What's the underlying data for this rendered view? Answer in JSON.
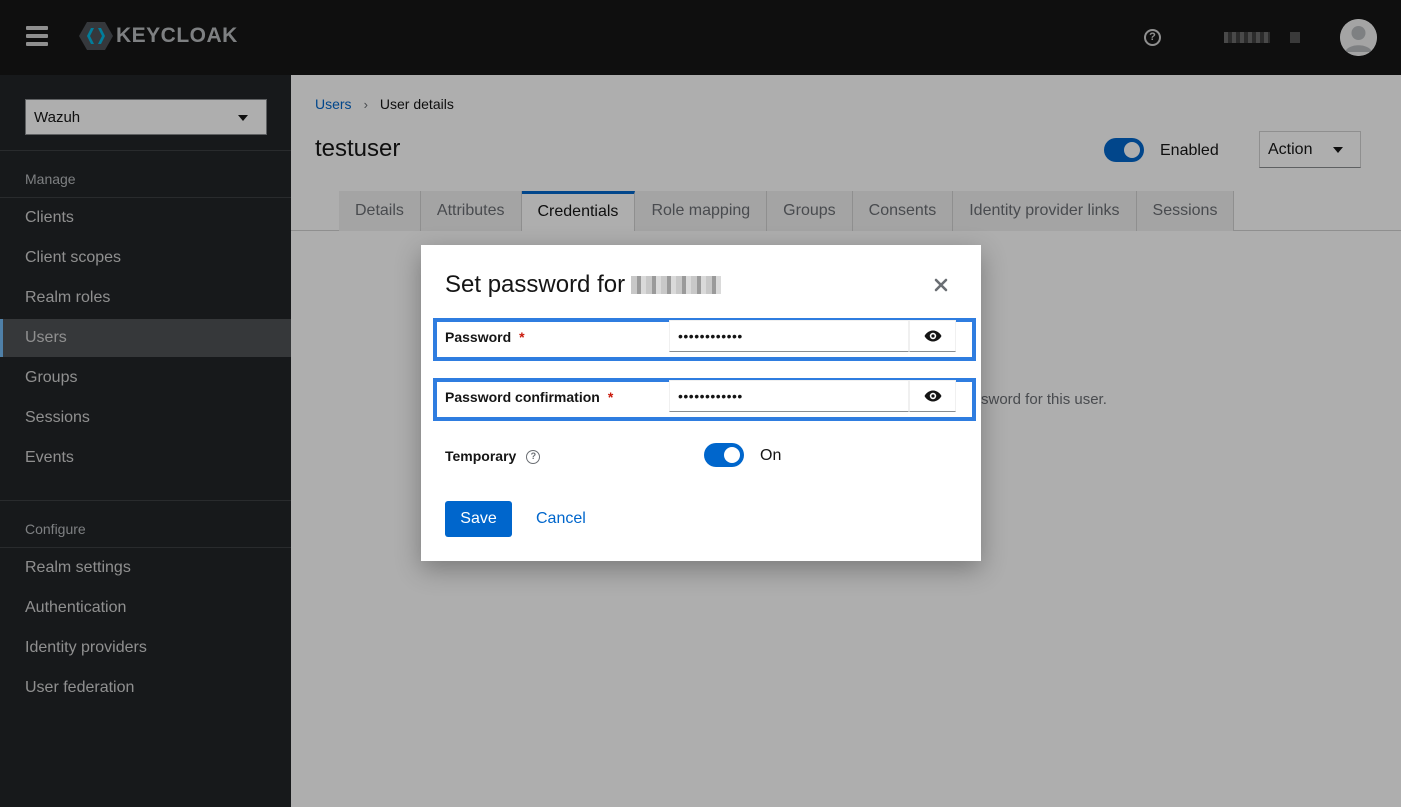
{
  "app": {
    "brand": "KEYCLOAK"
  },
  "sidebar": {
    "realm": "Wazuh",
    "groups": [
      {
        "label": "Manage",
        "items": [
          "Clients",
          "Client scopes",
          "Realm roles",
          "Users",
          "Groups",
          "Sessions",
          "Events"
        ]
      },
      {
        "label": "Configure",
        "items": [
          "Realm settings",
          "Authentication",
          "Identity providers",
          "User federation"
        ]
      }
    ],
    "active": "Users"
  },
  "breadcrumb": {
    "link": "Users",
    "current": "User details"
  },
  "page": {
    "title": "testuser",
    "enabled_label": "Enabled",
    "action_label": "Action",
    "tabs": [
      "Details",
      "Attributes",
      "Credentials",
      "Role mapping",
      "Groups",
      "Consents",
      "Identity provider links",
      "Sessions"
    ],
    "active_tab": "Credentials",
    "background_text": "sword for this user."
  },
  "modal": {
    "title": "Set password for",
    "password_label": "Password",
    "password_value": "••••••••••••",
    "confirm_label": "Password confirmation",
    "confirm_value": "••••••••••••",
    "required_mark": "*",
    "temporary_label": "Temporary",
    "temporary_state": "On",
    "save_label": "Save",
    "cancel_label": "Cancel"
  },
  "colors": {
    "accent": "#0066cc",
    "highlight": "#2f7de0",
    "masthead": "#151515",
    "sidebar": "#212427"
  }
}
